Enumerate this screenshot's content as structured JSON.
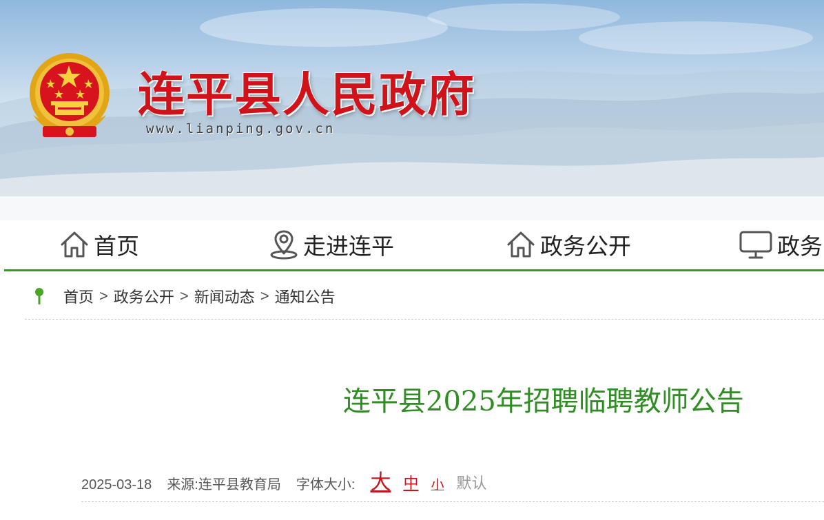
{
  "header": {
    "site_title": "连平县人民政府",
    "site_url": "www.lianping.gov.cn",
    "emblem_icon": "national-emblem-icon"
  },
  "nav": {
    "items": [
      {
        "label": "首页",
        "icon": "home-icon"
      },
      {
        "label": "走进连平",
        "icon": "location-pin-icon"
      },
      {
        "label": "政务公开",
        "icon": "home-icon"
      },
      {
        "label": "政务",
        "icon": "monitor-icon"
      }
    ],
    "accent_color": "#3a9a1e"
  },
  "breadcrumb": {
    "icon": "location-pin-icon",
    "items": [
      "首页",
      "政务公开",
      "新闻动态",
      "通知公告"
    ],
    "separator": ">"
  },
  "article": {
    "title": "连平县2025年招聘临聘教师公告",
    "title_color": "#2f8d23",
    "date": "2025-03-18",
    "source_label": "来源:",
    "source": "连平县教育局",
    "font_size_label": "字体大小:",
    "font_sizes": {
      "large": "大",
      "medium": "中",
      "small": "小",
      "default": "默认"
    },
    "font_size_link_color": "#c8141b"
  }
}
